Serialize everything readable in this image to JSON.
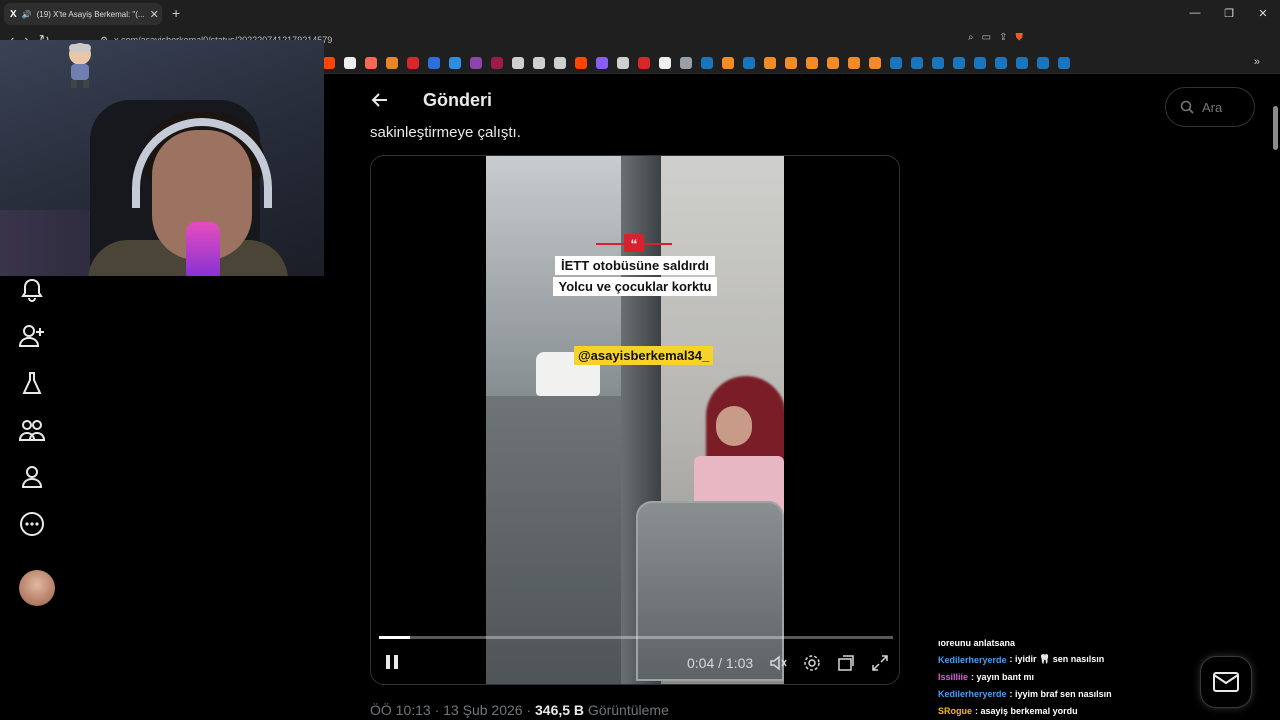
{
  "browser": {
    "tab_title": "(19) X'te Asayiş Berkemal: \"(...",
    "url": "x.com/asayisberkemal0/status/2022207412179214579",
    "close_glyph": "✕",
    "newtab_glyph": "+"
  },
  "page": {
    "title": "Gönderi",
    "search_placeholder": "Ara",
    "tweet_text": "sakinleştirmeye çalıştı.",
    "views_time": "ÖÖ 10:13 · 13 Şub 2026 · ",
    "views_count": "346,5 B",
    "views_label": " Görüntüleme"
  },
  "video": {
    "caption_line1": "İETT otobüsüne saldırdı",
    "caption_line2": "Yolcu ve çocuklar korktu",
    "handle": "@asayisberkemal34_",
    "timecode": "0:04 / 1:03",
    "progress_fraction": 0.06
  },
  "chat": {
    "messages": [
      {
        "user": "",
        "text": "ıoreunu anlatsana",
        "user_color": "#ffffff"
      },
      {
        "user": "Kedilerheryerde",
        "text": ": iyidir 🦷 sen nasılsın",
        "user_color": "#4a9df0"
      },
      {
        "user": "Issilliie",
        "text": ": yayın bant mı",
        "user_color": "#e05ad3"
      },
      {
        "user": "Kedilerheryerde",
        "text": ": iyyim braf sen nasılsın",
        "user_color": "#4a9df0"
      },
      {
        "user": "SRogue",
        "text": ": asayiş berkemal yordu",
        "user_color": "#f2b62a"
      }
    ]
  },
  "colors": {
    "accent": "#1d9bf0",
    "handle_bg": "#f5d32b",
    "quote_red": "#d8212c"
  }
}
